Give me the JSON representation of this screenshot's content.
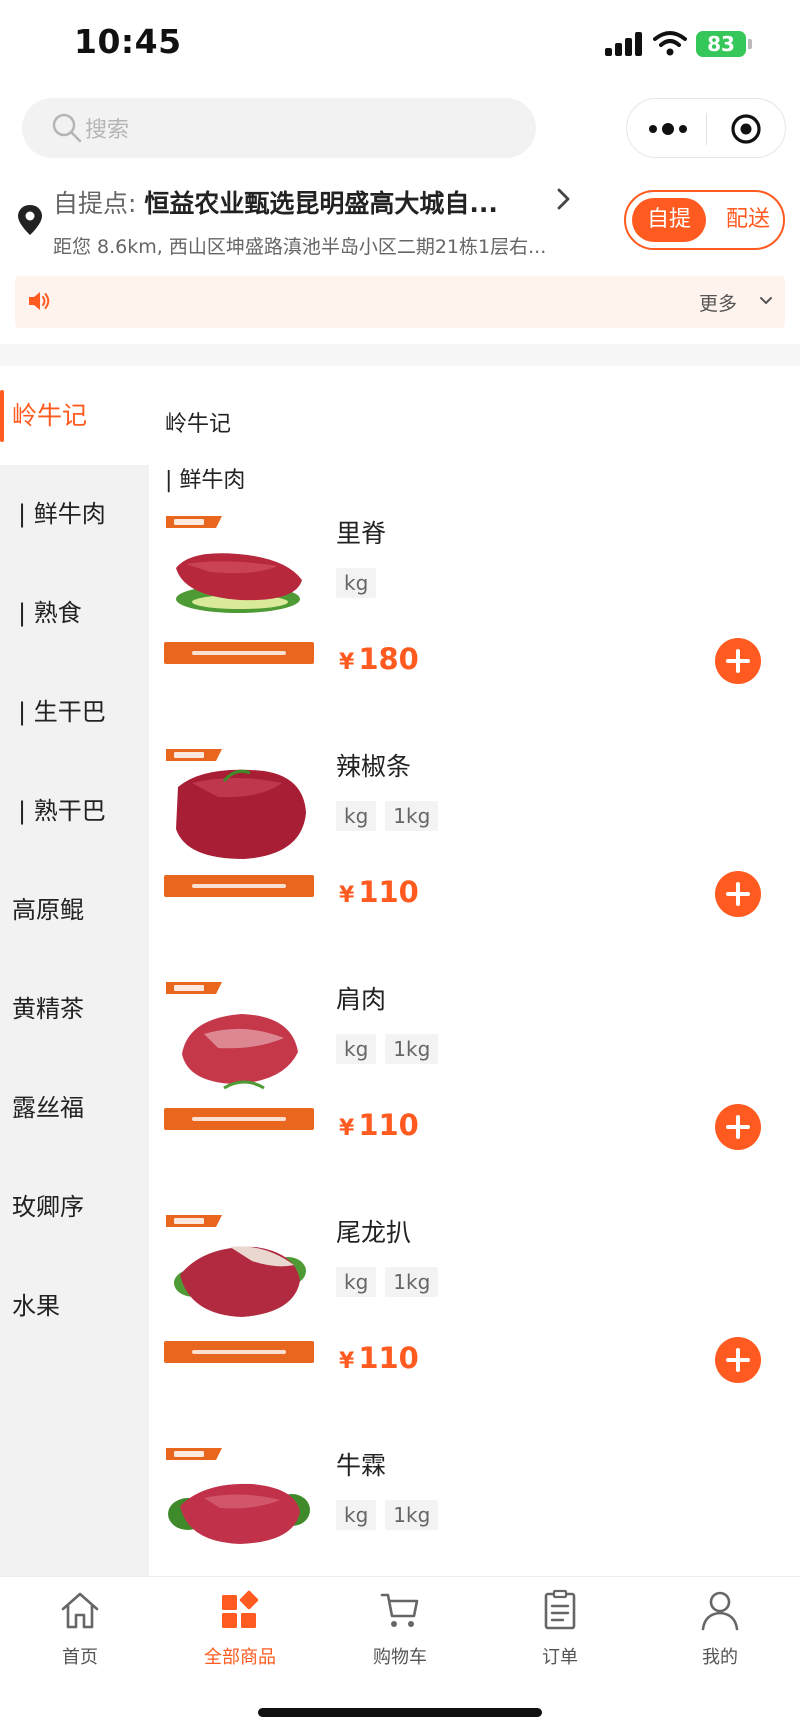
{
  "status_bar": {
    "time": "10:45",
    "battery": "83"
  },
  "search": {
    "placeholder": "搜索"
  },
  "pickup": {
    "label": "自提点:",
    "name": "恒益农业甄选昆明盛高大城自...",
    "address": "距您 8.6km, 西山区坤盛路滇池半岛小区二期21栋1层右..."
  },
  "delivery_mode": {
    "pickup_label": "自提",
    "delivery_label": "配送",
    "selected": "自提"
  },
  "notice": {
    "more_label": "更多"
  },
  "sidebar": {
    "items": [
      {
        "label": "岭牛记",
        "active": true
      },
      {
        "label": "| 鲜牛肉"
      },
      {
        "label": "| 熟食"
      },
      {
        "label": "| 生干巴"
      },
      {
        "label": "| 熟干巴"
      },
      {
        "label": "高原鲲"
      },
      {
        "label": "黄精茶"
      },
      {
        "label": "露丝福"
      },
      {
        "label": "玫卿序"
      },
      {
        "label": "水果"
      }
    ]
  },
  "content": {
    "section_title": "岭牛记",
    "subcategory_title": "| 鲜牛肉",
    "products": [
      {
        "name": "里脊",
        "tags": [
          "kg"
        ],
        "currency": "¥",
        "price": "180"
      },
      {
        "name": "辣椒条",
        "tags": [
          "kg",
          "1kg"
        ],
        "currency": "¥",
        "price": "110"
      },
      {
        "name": "肩肉",
        "tags": [
          "kg",
          "1kg"
        ],
        "currency": "¥",
        "price": "110"
      },
      {
        "name": "尾龙扒",
        "tags": [
          "kg",
          "1kg"
        ],
        "currency": "¥",
        "price": "110"
      },
      {
        "name": "牛霖",
        "tags": [
          "kg",
          "1kg"
        ]
      }
    ]
  },
  "tab_bar": {
    "tabs": [
      {
        "label": "首页",
        "icon": "home-icon"
      },
      {
        "label": "全部商品",
        "icon": "all-products-icon",
        "active": true
      },
      {
        "label": "购物车",
        "icon": "cart-icon"
      },
      {
        "label": "订单",
        "icon": "orders-icon"
      },
      {
        "label": "我的",
        "icon": "profile-icon"
      }
    ]
  },
  "colors": {
    "accent": "#ff5a1f",
    "notice_bg": "#fff3ed",
    "sidebar_bg": "#f2f2f2",
    "banner_orange": "#e8661d"
  }
}
